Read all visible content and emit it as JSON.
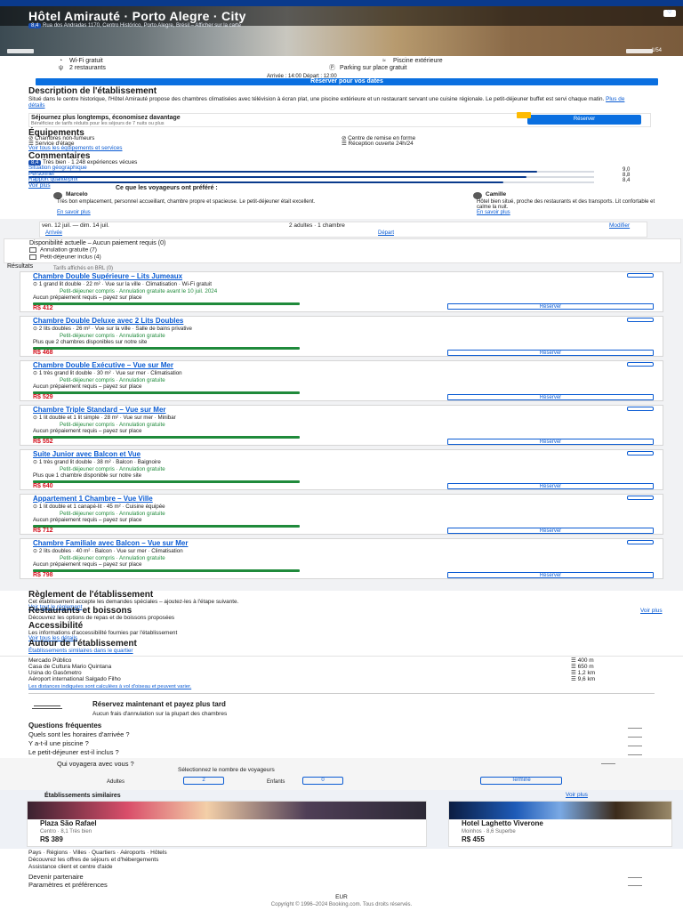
{
  "header": {
    "title": "Hôtel Amirauté · Porto Alegre · City",
    "address": "Rua dos Andradas 1170, Centro Histórico, Porto Alegre, Brésil – Afficher sur la carte",
    "rating_badge": "8,4",
    "rating_text": "Très bien · 1 248 expériences vécues",
    "photo_counter": "1/54",
    "favorite_label": "♡"
  },
  "facts": {
    "wifi": "Wi-Fi gratuit",
    "pool": "Piscine extérieure",
    "restaurants": "2 restaurants",
    "parking": "Parking sur place gratuit",
    "checkin": "Arrivée : 14:00  Départ : 12:00"
  },
  "cta": "Réserver pour vos dates",
  "description": {
    "title": "Description de l'établissement",
    "text": "Situé dans le centre historique, l'Hôtel Amirauté propose des chambres climatisées avec télévision à écran plat, une piscine extérieure et un restaurant servant une cuisine régionale. Le petit-déjeuner buffet est servi chaque matin.",
    "more": "Plus de détails",
    "promo_text": "Séjournez plus longtemps, économisez davantage",
    "promo_sub": "Bénéficiez de tarifs réduits pour les séjours de 7 nuits ou plus",
    "promo_button": "Réserver"
  },
  "equipements": {
    "title": "Équipements",
    "items": [
      "Chambres non-fumeurs",
      "Centre de remise en forme",
      "Service d'étage",
      "Réception ouverte 24h/24"
    ],
    "link": "Voir tous les équipements et services"
  },
  "scores": {
    "title": "Commentaires",
    "badge": "8,4",
    "summary": "Très bien · 1 248 expériences vécues",
    "items": [
      {
        "label": "Situation géographique",
        "score": "9,0",
        "value": 0.9
      },
      {
        "label": "Personnel",
        "score": "8,8",
        "value": 0.88
      },
      {
        "label": "Rapport qualité/prix",
        "score": "8,4",
        "value": 0.84
      }
    ],
    "link": "Voir plus",
    "reviews_title": "Ce que les voyageurs ont préféré :",
    "review1_name": "Marcelo",
    "review1_text": "Très bon emplacement, personnel accueillant, chambre propre et spacieuse. Le petit-déjeuner était excellent.",
    "review1_more": "En savoir plus",
    "review2_name": "Camille",
    "review2_text": "Hôtel bien situé, proche des restaurants et des transports. Lit confortable et calme la nuit.",
    "review2_more": "En savoir plus"
  },
  "search": {
    "dates": "ven. 12 juil. — dim. 14 juil.",
    "guests": "2 adultes · 1 chambre",
    "modify": "Modifier",
    "arrival_label": "Arrivée",
    "departure_label": "Départ",
    "filter_title": "Disponibilité actuelle – Aucun paiement requis (0)",
    "opt1": "Annulation gratuite (7)",
    "opt2": "Petit-déjeuner inclus (4)",
    "results_label": "Résultats",
    "prices_note": "Tarifs affichés en BRL (0)"
  },
  "rooms": [
    {
      "name": "Chambre Double Supérieure – Lits Jumeaux",
      "l1": "1 grand lit double · 22 m² · Vue sur la ville · Climatisation · Wi-Fi gratuit",
      "l2": "Petit-déjeuner compris · Annulation gratuite avant le 10 juil. 2024",
      "l3": "Aucun prépaiement requis – payez sur place",
      "price": "R$ 412",
      "reserve": "Réserver"
    },
    {
      "name": "Chambre Double Deluxe avec 2 Lits Doubles",
      "l1": "2 lits doubles · 26 m² · Vue sur la ville · Salle de bains privative",
      "l2": "Petit-déjeuner compris · Annulation gratuite",
      "l3": "Plus que 2 chambres disponibles sur notre site",
      "price": "R$ 468",
      "reserve": "Réserver"
    },
    {
      "name": "Chambre Double Exécutive – Vue sur Mer",
      "l1": "1 très grand lit double · 30 m² · Vue sur mer · Climatisation",
      "l2": "Petit-déjeuner compris · Annulation gratuite",
      "l3": "Aucun prépaiement requis – payez sur place",
      "price": "R$ 529",
      "reserve": "Réserver"
    },
    {
      "name": "Chambre Triple Standard – Vue sur Mer",
      "l1": "1 lit double et 1 lit simple · 28 m² · Vue sur mer · Minibar",
      "l2": "Petit-déjeuner compris · Annulation gratuite",
      "l3": "Aucun prépaiement requis – payez sur place",
      "price": "R$ 552",
      "reserve": "Réserver"
    },
    {
      "name": "Suite Junior avec Balcon et Vue",
      "l1": "1 très grand lit double · 38 m² · Balcon · Baignoire",
      "l2": "Petit-déjeuner compris · Annulation gratuite",
      "l3": "Plus que 1 chambre disponible sur notre site",
      "price": "R$ 640",
      "reserve": "Réserver"
    },
    {
      "name": "Appartement 1 Chambre – Vue Ville",
      "l1": "1 lit double et 1 canapé-lit · 45 m² · Cuisine équipée",
      "l2": "Petit-déjeuner compris · Annulation gratuite",
      "l3": "Aucun prépaiement requis – payez sur place",
      "price": "R$ 712",
      "reserve": "Réserver"
    },
    {
      "name": "Chambre Familiale avec Balcon – Vue sur Mer",
      "l1": "2 lits doubles · 40 m² · Balcon · Vue sur mer · Climatisation",
      "l2": "Petit-déjeuner compris · Annulation gratuite",
      "l3": "Aucun prépaiement requis – payez sur place",
      "price": "R$ 798",
      "reserve": "Réserver"
    }
  ],
  "more_sections": {
    "rules_title": "Règlement de l'établissement",
    "rules_text": "Cet établissement accepte les demandes spéciales – ajoutez-les à l'étape suivante.",
    "rules_link": "Voir tout le règlement",
    "food_title": "Restaurants et boissons",
    "food_text": "Découvrez les options de repas et de boissons proposées",
    "food_link": "Voir plus",
    "access_title": "Accessibilité",
    "access_text": "Les informations d'accessibilité fournies par l'établissement",
    "access_link": "Voir tous les détails",
    "surround_title": "Autour de l'établissement",
    "surround_link": "Établissements similaires dans le quartier",
    "poi": [
      {
        "name": "Mercado Público",
        "dist": "400 m"
      },
      {
        "name": "Casa de Cultura Mario Quintana",
        "dist": "650 m"
      },
      {
        "name": "Usina do Gasômetro",
        "dist": "1,2 km"
      },
      {
        "name": "Aéroport international Salgado Filho",
        "dist": "9,6 km"
      }
    ],
    "poi_note": "Les distances indiquées sont calculées à vol d'oiseau et peuvent varier."
  },
  "payment": {
    "title": "Réservez maintenant et payez plus tard",
    "text": "Aucun frais d'annulation sur la plupart des chambres"
  },
  "faq": {
    "q1": "Questions fréquentes",
    "q2": "Quels sont les horaires d'arrivée ?",
    "q3": "Y a-t-il une piscine ?",
    "q4": "Le petit-déjeuner est-il inclus ?"
  },
  "guests_picker": {
    "title": "Qui voyagera avec vous ?",
    "subtitle": "Sélectionnez le nombre de voyageurs",
    "adults_label": "Adultes",
    "adults_value": "2",
    "children_label": "Enfants",
    "children_value": "0",
    "done": "Terminé"
  },
  "similar": {
    "title": "Établissements similaires",
    "link": "Voir plus",
    "cards": [
      {
        "name": "Plaza São Rafael",
        "sub": "Centro · 8,1 Très bien",
        "price": "R$ 389"
      },
      {
        "name": "Hotel Laghetto Viverone",
        "sub": "Moinhos · 8,6 Superbe",
        "price": "R$ 455"
      }
    ]
  },
  "bottom": {
    "line1": "Pays · Régions · Villes · Quartiers · Aéroports · Hôtels",
    "line2": "Découvrez les offres de séjours et d'hébergements",
    "line3": "Assistance client et centre d'aide",
    "line4": "Devenir partenaire",
    "line5": "Paramètres et préférences",
    "currency": "EUR",
    "copyright": "Copyright © 1996–2024 Booking.com. Tous droits réservés."
  }
}
